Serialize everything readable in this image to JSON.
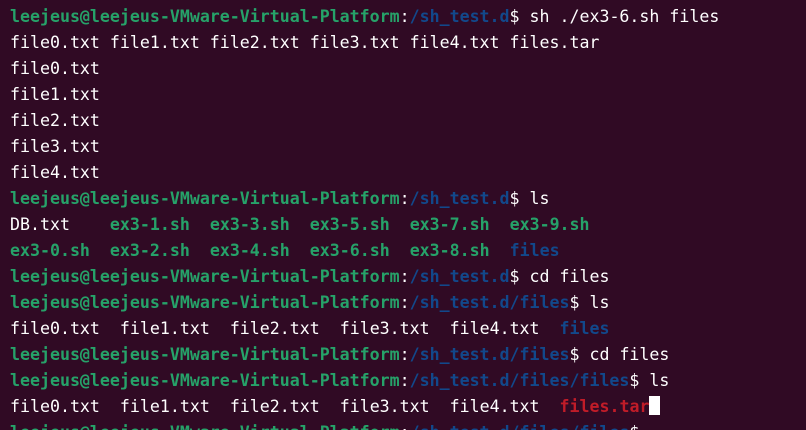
{
  "terminal": {
    "prompt_user": "leejeus@leejeus-VMware-Virtual-Platform",
    "prompt_colon": ":",
    "prompt_dollar": "$ ",
    "paths": {
      "p1": "/sh_test.d",
      "p2": "/sh_test.d/files",
      "p3": "/sh_test.d/files/files"
    },
    "commands": {
      "c1": "sh ./ex3-6.sh files",
      "c2": "ls",
      "c3": "cd files",
      "c4": "ls",
      "c5": "cd files",
      "c6": "ls"
    },
    "output1": "file0.txt file1.txt file2.txt file3.txt file4.txt files.tar",
    "output_files": [
      "file0.txt",
      "file1.txt",
      "file2.txt",
      "file3.txt",
      "file4.txt"
    ],
    "ls1": {
      "row1": [
        "DB.txt",
        "ex3-1.sh",
        "ex3-3.sh",
        "ex3-5.sh",
        "ex3-7.sh",
        "ex3-9.sh"
      ],
      "row2": [
        "ex3-0.sh",
        "ex3-2.sh",
        "ex3-4.sh",
        "ex3-6.sh",
        "ex3-8.sh",
        "files"
      ]
    },
    "ls2": [
      "file0.txt",
      "file1.txt",
      "file2.txt",
      "file3.txt",
      "file4.txt",
      "files"
    ],
    "ls3": [
      "file0.txt",
      "file1.txt",
      "file2.txt",
      "file3.txt",
      "file4.txt",
      "files.tar"
    ]
  },
  "colors": {
    "background": "#300a24",
    "user": "#26a269",
    "path": "#12488b",
    "archive": "#c01c28",
    "text": "#ffffff"
  }
}
